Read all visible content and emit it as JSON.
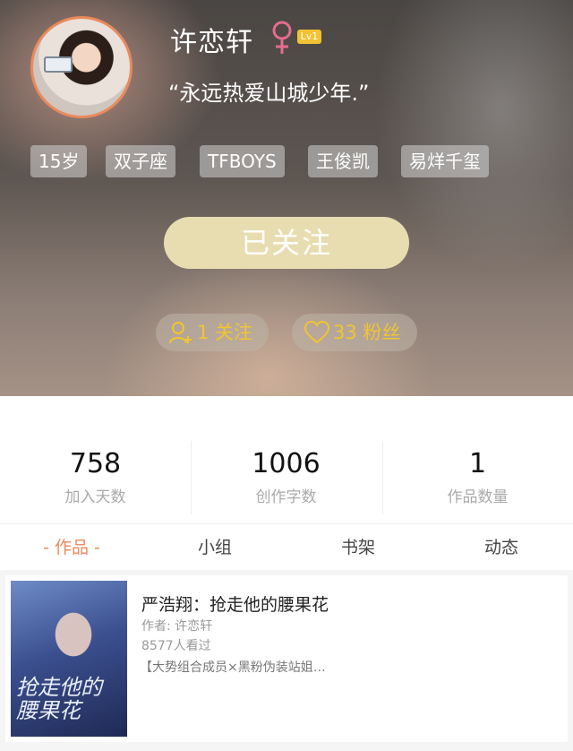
{
  "profile": {
    "name": "许恋轩",
    "level": "Lv1",
    "motto": "“永远热爱山城少年.”",
    "tags": [
      "15岁",
      "双子座",
      "TFBOYS",
      "王俊凯",
      "易烊千玺"
    ],
    "follow_button": "已关注",
    "following": "1 关注",
    "fans": "33 粉丝"
  },
  "stats": [
    {
      "value": "758",
      "label": "加入天数"
    },
    {
      "value": "1006",
      "label": "创作字数"
    },
    {
      "value": "1",
      "label": "作品数量"
    }
  ],
  "tabs": [
    "- 作品 -",
    "小组",
    "书架",
    "动态"
  ],
  "works": [
    {
      "title": "严浩翔：抢走他的腰果花",
      "author": "作者: 许恋轩",
      "views": "8577人看过",
      "description": "【大势组合成员×黑粉伪装站姐…",
      "cover_text": "抢走他的腰果花"
    }
  ],
  "colors": {
    "accent": "#ea8a5c",
    "gold": "#f0c531",
    "button": "#e8ddb0"
  }
}
